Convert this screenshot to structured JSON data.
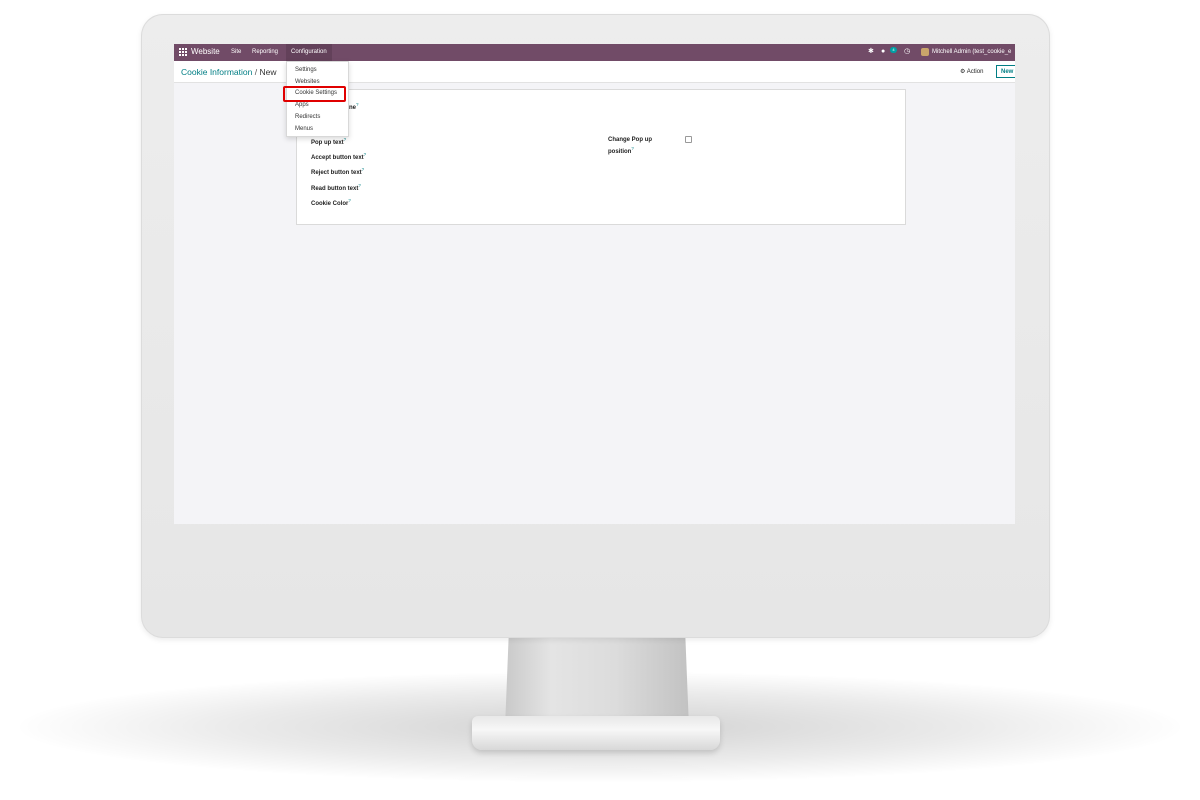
{
  "navbar": {
    "app_name": "Website",
    "menus": [
      "Site",
      "Reporting",
      "Configuration"
    ],
    "chat_badge": "4",
    "user": "Mitchell Admin (test_cookie_e"
  },
  "control_panel": {
    "breadcrumb_parent": "Cookie Information",
    "breadcrumb_separator": "/",
    "breadcrumb_current": "New",
    "action_label": "Action",
    "new_label": "New"
  },
  "dropdown": {
    "items": [
      "Settings",
      "Websites",
      "Cookie Settings",
      "Apps",
      "Redirects",
      "Menus"
    ],
    "highlighted": "Cookie Settings"
  },
  "form": {
    "name_label_fragment": "ne",
    "fields_left": [
      "Pop up text",
      "Accept button text",
      "Reject button text",
      "Read button text",
      "Cookie Color"
    ],
    "field_right_line1": "Change Pop up",
    "field_right_line2": "position",
    "help_marker": "?",
    "change_position_checked": false
  },
  "colors": {
    "navbar": "#714b67",
    "accent": "#017e84",
    "highlight": "#e00000"
  }
}
